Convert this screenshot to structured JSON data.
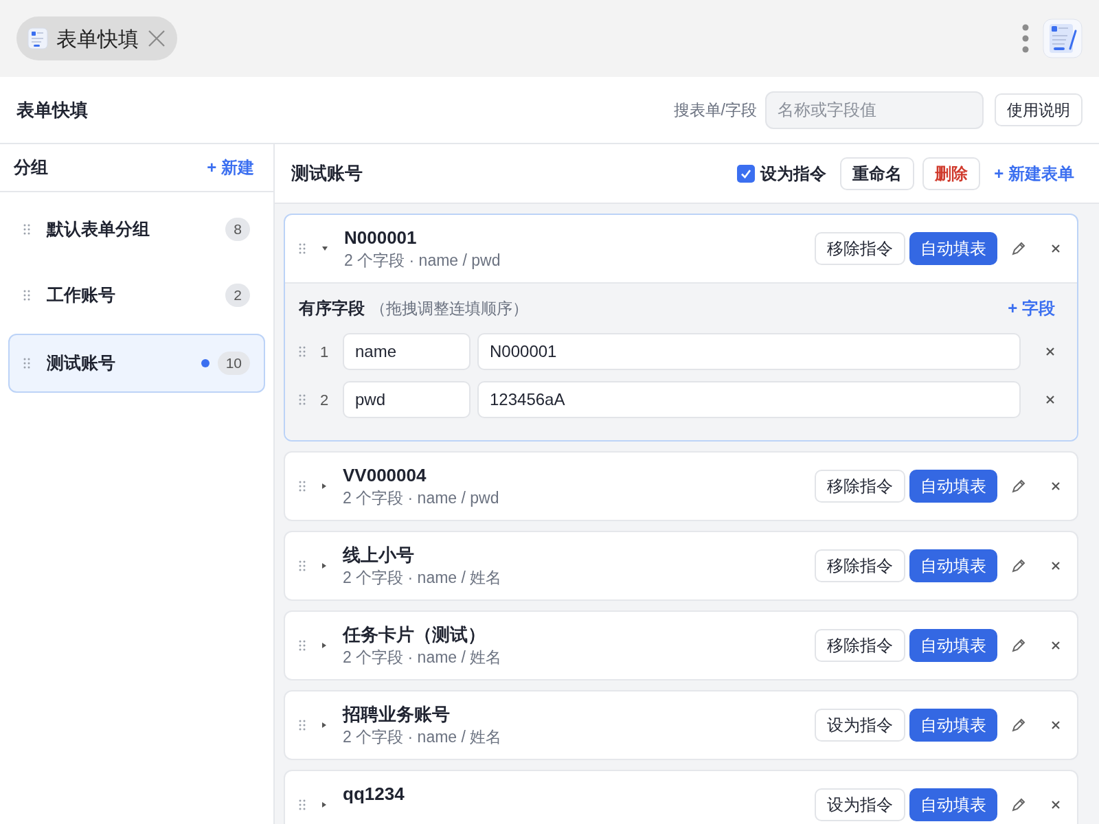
{
  "tab": {
    "title": "表单快填"
  },
  "header": {
    "title": "表单快填",
    "search_label": "搜表单/字段",
    "search": {
      "placeholder": "名称或字段值"
    },
    "help_button": "使用说明"
  },
  "sidebar": {
    "title": "分组",
    "new_button": "+ 新建",
    "groups": [
      {
        "name": "默认表单分组",
        "count": "8",
        "selected": false,
        "unsaved": false
      },
      {
        "name": "工作账号",
        "count": "2",
        "selected": false,
        "unsaved": false
      },
      {
        "name": "测试账号",
        "count": "10",
        "selected": true,
        "unsaved": true
      }
    ]
  },
  "content": {
    "title": "测试账号",
    "command": {
      "label": "设为指令",
      "checked": true
    },
    "rename_button": "重命名",
    "delete_button": "删除",
    "new_form_button": "+ 新建表单",
    "forms": [
      {
        "name": "N000001",
        "summary": "2 个字段 · name / pwd",
        "expanded": true,
        "command_button": "移除指令",
        "fill_button": "自动填表",
        "fields_title": "有序字段",
        "fields_hint": "（拖拽调整连填顺序）",
        "add_field": "+ 字段",
        "fields": [
          {
            "index": "1",
            "key": "name",
            "value": "N000001"
          },
          {
            "index": "2",
            "key": "pwd",
            "value": "123456aA"
          }
        ]
      },
      {
        "name": "VV000004",
        "summary": "2 个字段 · name / pwd",
        "expanded": false,
        "command_button": "移除指令",
        "fill_button": "自动填表"
      },
      {
        "name": "线上小号",
        "summary": "2 个字段 · name / 姓名",
        "expanded": false,
        "command_button": "移除指令",
        "fill_button": "自动填表"
      },
      {
        "name": "任务卡片（测试）",
        "summary": "2 个字段 · name / 姓名",
        "expanded": false,
        "command_button": "移除指令",
        "fill_button": "自动填表"
      },
      {
        "name": "招聘业务账号",
        "summary": "2 个字段 · name / 姓名",
        "expanded": false,
        "command_button": "设为指令",
        "fill_button": "自动填表"
      },
      {
        "name": "qq1234",
        "expanded": false,
        "command_button": "设为指令",
        "fill_button": "自动填表"
      }
    ]
  }
}
